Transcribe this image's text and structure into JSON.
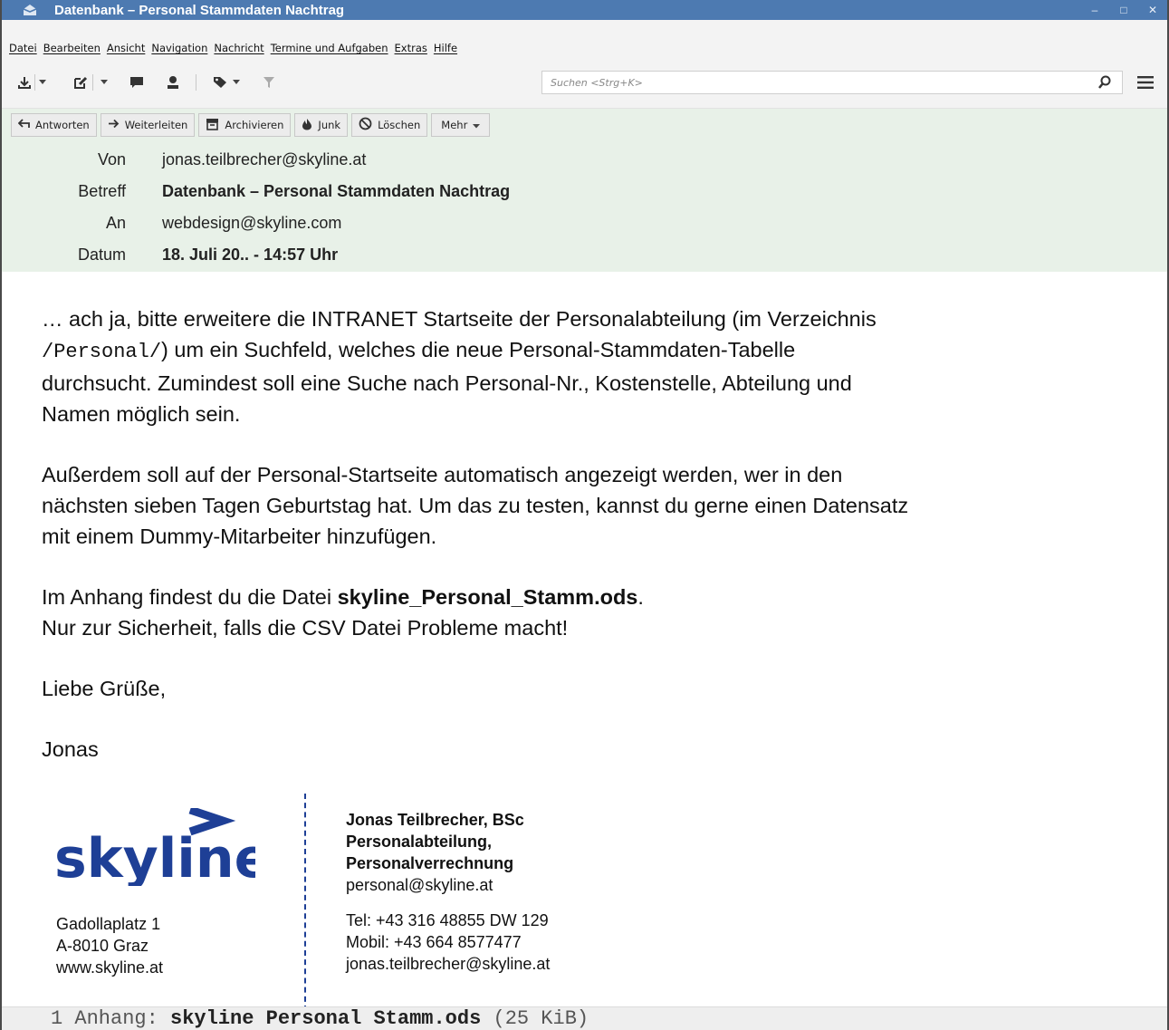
{
  "window": {
    "title": "Datenbank – Personal Stammdaten Nachtrag",
    "controls": {
      "minimize": "–",
      "maximize": "□",
      "close": "✕"
    },
    "titlebar_color": "#4d7ab1"
  },
  "menu": [
    "Datei",
    "Bearbeiten",
    "Ansicht",
    "Navigation",
    "Nachricht",
    "Termine und Aufgaben",
    "Extras",
    "Hilfe"
  ],
  "toolbar": {
    "icons": [
      "download-icon",
      "write-icon",
      "chat-icon",
      "contact-icon",
      "tag-icon",
      "filter-icon"
    ],
    "search_placeholder": "Suchen <Strg+K>"
  },
  "message_actions": [
    {
      "label": "Antworten",
      "icon": "reply-icon"
    },
    {
      "label": "Weiterleiten",
      "icon": "forward-icon"
    },
    {
      "label": "Archivieren",
      "icon": "archive-icon"
    },
    {
      "label": "Junk",
      "icon": "junk-icon"
    },
    {
      "label": "Löschen",
      "icon": "delete-icon"
    },
    {
      "label": "Mehr",
      "icon": "dropdown-icon"
    }
  ],
  "header": {
    "from_label": "Von",
    "from": "jonas.teilbrecher@skyline.at",
    "subject_label": "Betreff",
    "subject": "Datenbank – Personal Stammdaten Nachtrag",
    "to_label": "An",
    "to": "webdesign@skyline.com",
    "date_label": "Datum",
    "date": "18. Juli 20.. - 14:57 Uhr"
  },
  "body": {
    "p1_a": "… ach ja, bitte erweitere die INTRANET Startseite der Personalabteilung (im Verzeichnis",
    "p1_mono": "/Personal/",
    "p1_b": ") um ein Suchfeld, welches die neue Personal-Stammdaten-Tabelle",
    "p1_c": "durchsucht. Zumindest soll eine Suche nach Personal-Nr., Kostenstelle, Abteilung und",
    "p1_d": "Namen möglich sein.",
    "p2_a": "Außerdem soll auf der Personal-Startseite automatisch angezeigt werden, wer in den",
    "p2_b": "nächsten sieben Tagen Geburtstag hat. Um das zu testen, kannst du gerne einen Datensatz",
    "p2_c": "mit einem Dummy-Mitarbeiter hinzufügen.",
    "p3_a": "Im Anhang findest du die Datei ",
    "p3_file": "skyline_Personal_Stamm.ods",
    "p3_b": ".",
    "p3_c": "Nur zur Sicherheit, falls die CSV Datei Probleme macht!",
    "greeting": "Liebe Grüße,",
    "name": "Jonas"
  },
  "signature": {
    "logo_text": "skyline",
    "address": [
      "Gadollaplatz 1",
      "A-8010 Graz",
      "www.skyline.at"
    ],
    "name": "Jonas Teilbrecher, BSc",
    "dept1": "Personalabteilung,",
    "dept2": "Personalverrechnung",
    "email1": "personal@skyline.at",
    "tel": "Tel: +43 316 48855 DW 129",
    "mobile": "Mobil: +43 664 8577477",
    "email2": "jonas.teilbrecher@skyline.at",
    "brand_color": "#1e3f96"
  },
  "attachment": {
    "count_label": "1 Anhang: ",
    "filename": "skyline Personal Stamm.ods",
    "size": " (25 KiB)"
  }
}
